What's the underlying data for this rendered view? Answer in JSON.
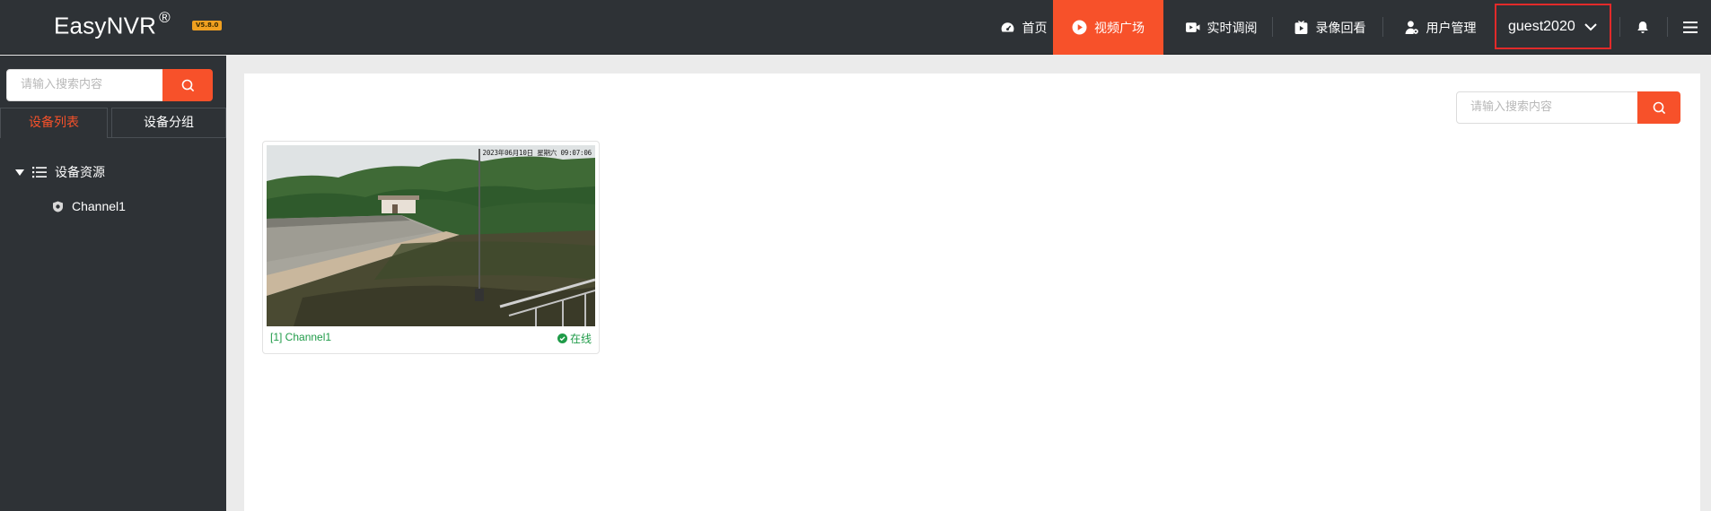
{
  "app": {
    "logo": "EasyNVR",
    "logo_mark": "®",
    "version": "V5.8.0"
  },
  "nav": {
    "items": [
      {
        "label": "首页",
        "icon": "dashboard-icon"
      },
      {
        "label": "视频广场",
        "icon": "play-circle-icon",
        "active": true
      },
      {
        "label": "实时调阅",
        "icon": "video-camera-icon"
      },
      {
        "label": "录像回看",
        "icon": "playback-icon"
      },
      {
        "label": "用户管理",
        "icon": "user-gear-icon"
      }
    ],
    "username": "guest2020"
  },
  "sidebar": {
    "search_placeholder": "请输入搜索内容",
    "tabs": [
      {
        "label": "设备列表",
        "active": true
      },
      {
        "label": "设备分组",
        "active": false
      }
    ],
    "tree": {
      "root_label": "设备资源",
      "children": [
        {
          "label": "Channel1"
        }
      ]
    }
  },
  "main": {
    "search_placeholder": "请输入搜索内容",
    "cards": [
      {
        "name": "[1] Channel1",
        "status": "在线",
        "overlay_text": "2023年06月10日 星期六 09:07:06"
      }
    ]
  },
  "colors": {
    "accent": "#f7512a",
    "header_bg": "#2e3236",
    "online": "#1f9b48",
    "highlight_border": "#e22a2a"
  }
}
